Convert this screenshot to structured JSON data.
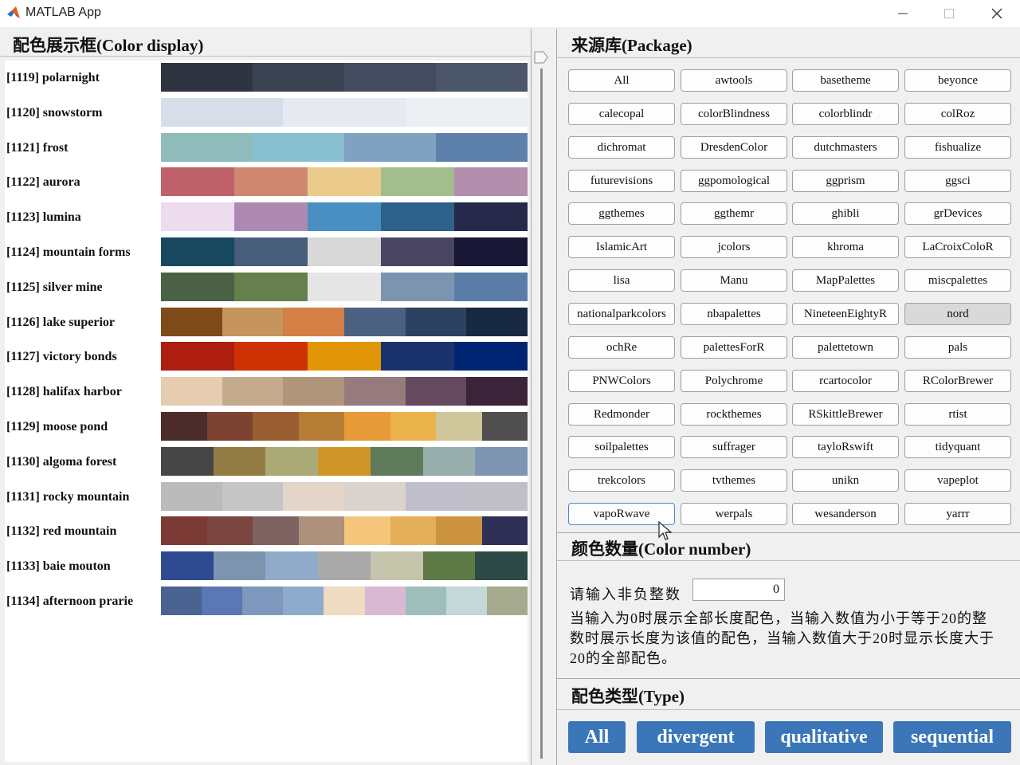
{
  "window": {
    "title": "MATLAB App"
  },
  "display": {
    "title": "配色展示框(Color display)",
    "palettes": [
      {
        "label": "[1119] polarnight",
        "colors": [
          "#2e3440",
          "#3b4252",
          "#434c5e",
          "#4c566a"
        ]
      },
      {
        "label": "[1120] snowstorm",
        "colors": [
          "#d8dee9",
          "#e5e9f0",
          "#eceff4"
        ]
      },
      {
        "label": "[1121] frost",
        "colors": [
          "#8fbcbb",
          "#88c0d0",
          "#81a1c1",
          "#5e81ac"
        ]
      },
      {
        "label": "[1122] aurora",
        "colors": [
          "#bf616a",
          "#d08770",
          "#ebcb8b",
          "#a3be8c",
          "#b48ead"
        ]
      },
      {
        "label": "[1123] lumina",
        "colors": [
          "#eddcee",
          "#ae89b2",
          "#4a8fc1",
          "#2e6189",
          "#26294a"
        ]
      },
      {
        "label": "[1124] mountain forms",
        "colors": [
          "#184860",
          "#485d7a",
          "#d8d8d8",
          "#4a4560",
          "#171735"
        ]
      },
      {
        "label": "[1125] silver mine",
        "colors": [
          "#4b6145",
          "#657f4d",
          "#e6e6e6",
          "#7d94b1",
          "#5a7da7"
        ]
      },
      {
        "label": "[1126] lake superior",
        "colors": [
          "#7e4a1a",
          "#c6955e",
          "#d37f46",
          "#4a6182",
          "#2d4161",
          "#172942"
        ]
      },
      {
        "label": "[1127] victory bonds",
        "colors": [
          "#ad1d10",
          "#cd3205",
          "#e19608",
          "#1b336d",
          "#002573"
        ]
      },
      {
        "label": "[1128] halifax harbor",
        "colors": [
          "#e6ccb0",
          "#c3aa8d",
          "#af957b",
          "#957b7e",
          "#64495f",
          "#3b2339"
        ]
      },
      {
        "label": "[1129] moose pond",
        "colors": [
          "#4c2b2b",
          "#7c4332",
          "#985e32",
          "#b57d36",
          "#e69a38",
          "#ebb34b",
          "#cec69a",
          "#4f4f4f"
        ]
      },
      {
        "label": "[1130] algoma forest",
        "colors": [
          "#464646",
          "#947d45",
          "#a9aa75",
          "#d0962a",
          "#5f7b5b",
          "#99afad",
          "#7d95b1"
        ]
      },
      {
        "label": "[1131] rocky mountain",
        "colors": [
          "#bbbbbb",
          "#c5c5c5",
          "#e3d5c8",
          "#dbd2cd",
          "#bfbfcb",
          "#bfbfca"
        ]
      },
      {
        "label": "[1132] red mountain",
        "colors": [
          "#7b3a35",
          "#7b4540",
          "#7e6260",
          "#ad917c",
          "#f5c57b",
          "#e5ae59",
          "#cc9441",
          "#2e3058"
        ]
      },
      {
        "label": "[1133] baie mouton",
        "colors": [
          "#2e4a91",
          "#7c94ae",
          "#8fabc9",
          "#a9a9a9",
          "#c4c4ab",
          "#5e7a47",
          "#2e4a47"
        ]
      },
      {
        "label": "[1134] afternoon prarie",
        "colors": [
          "#4b6390",
          "#5b77b4",
          "#7e98bd",
          "#8fabcb",
          "#eedbc2",
          "#d9b9d1",
          "#9ebebc",
          "#c4d7d9",
          "#a5a98d"
        ]
      }
    ]
  },
  "package": {
    "title": "来源库(Package)",
    "selected": "nord",
    "focused": "vapoRwave",
    "buttons": [
      "All",
      "awtools",
      "basetheme",
      "beyonce",
      "calecopal",
      "colorBlindness",
      "colorblindr",
      "colRoz",
      "dichromat",
      "DresdenColor",
      "dutchmasters",
      "fishualize",
      "futurevisions",
      "ggpomological",
      "ggprism",
      "ggsci",
      "ggthemes",
      "ggthemr",
      "ghibli",
      "grDevices",
      "IslamicArt",
      "jcolors",
      "khroma",
      "LaCroixColoR",
      "lisa",
      "Manu",
      "MapPalettes",
      "miscpalettes",
      "nationalparkcolors",
      "nbapalettes",
      "NineteenEightyR",
      "nord",
      "ochRe",
      "palettesForR",
      "palettetown",
      "pals",
      "PNWColors",
      "Polychrome",
      "rcartocolor",
      "RColorBrewer",
      "Redmonder",
      "rockthemes",
      "RSkittleBrewer",
      "rtist",
      "soilpalettes",
      "suffrager",
      "tayloRswift",
      "tidyquant",
      "trekcolors",
      "tvthemes",
      "unikn",
      "vapeplot",
      "vapoRwave",
      "werpals",
      "wesanderson",
      "yarrr"
    ]
  },
  "color_number": {
    "title": "颜色数量(Color number)",
    "input_label": "请输入非负整数",
    "input_value": "0",
    "description": "当输入为0时展示全部长度配色，当输入数值为小于等于20的整数时展示长度为该值的配色，当输入数值大于20时显示长度大于20的全部配色。"
  },
  "type": {
    "title": "配色类型(Type)",
    "buttons": [
      "All",
      "divergent",
      "qualitative",
      "sequential"
    ],
    "accent": "#3a76b8"
  }
}
